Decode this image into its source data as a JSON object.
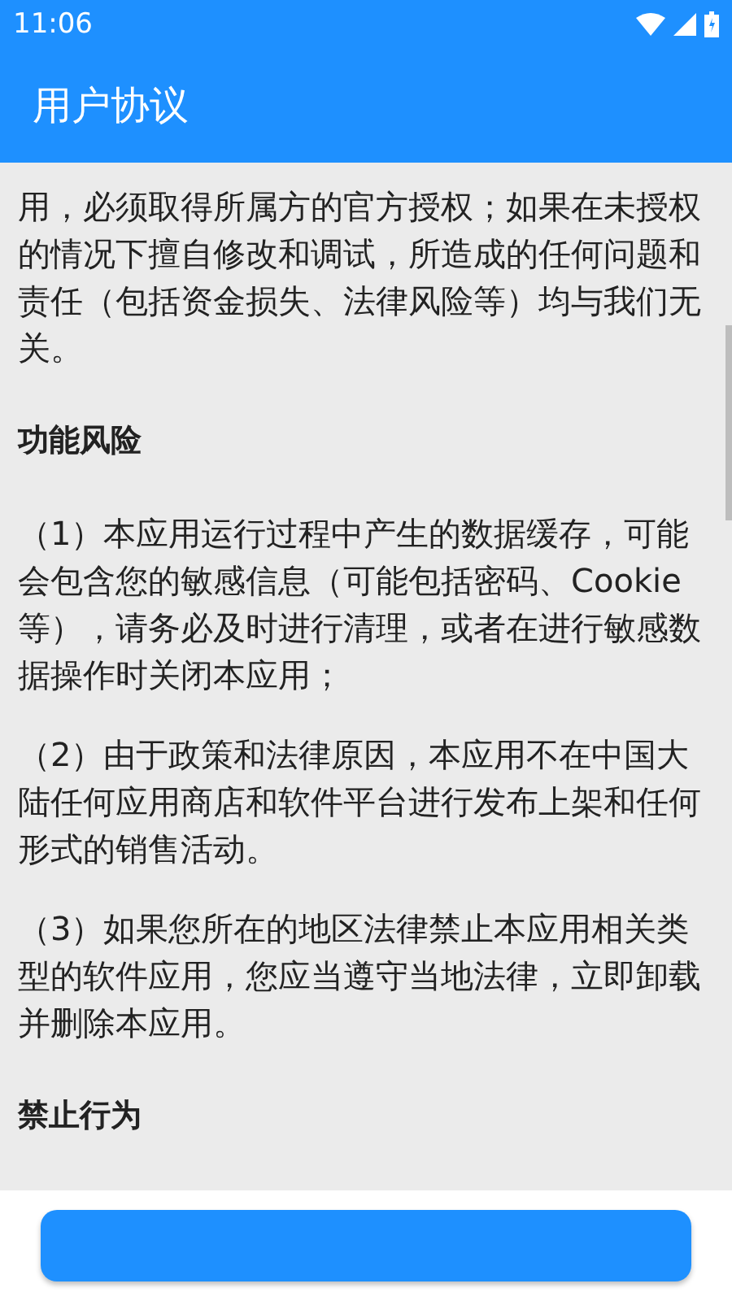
{
  "status_bar": {
    "time": "11:06"
  },
  "app_bar": {
    "title": "用户协议"
  },
  "content": [
    {
      "kind": "paragraph",
      "text": "用，必须取得所属方的官方授权；如果在未授权的情况下擅自修改和调试，所造成的任何问题和责任（包括资金损失、法律风险等）均与我们无关。"
    },
    {
      "kind": "heading",
      "text": "功能风险"
    },
    {
      "kind": "paragraph",
      "text": "（1）本应用运行过程中产生的数据缓存，可能会包含您的敏感信息（可能包括密码、Cookie等），请务必及时进行清理，或者在进行敏感数据操作时关闭本应用；"
    },
    {
      "kind": "paragraph",
      "text": "（2）由于政策和法律原因，本应用不在中国大陆任何应用商店和软件平台进行发布上架和任何形式的销售活动。"
    },
    {
      "kind": "paragraph",
      "text": "（3）如果您所在的地区法律禁止本应用相关类型的软件应用，您应当遵守当地法律，立即卸载并删除本应用。"
    },
    {
      "kind": "heading",
      "text": "禁止行为"
    }
  ]
}
